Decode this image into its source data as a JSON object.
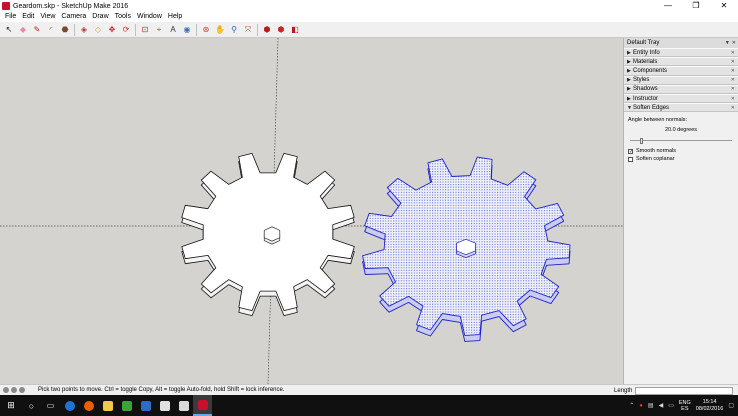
{
  "window": {
    "title": "Geardom.skp - SketchUp Make 2016",
    "minimize": "—",
    "maximize": "❐",
    "close": "✕"
  },
  "menu": [
    "File",
    "Edit",
    "View",
    "Camera",
    "Draw",
    "Tools",
    "Window",
    "Help"
  ],
  "toolbar": {
    "tools": [
      {
        "name": "select-tool",
        "glyph": "↖",
        "color": "#111111"
      },
      {
        "name": "eraser-tool",
        "glyph": "◆",
        "color": "#e887b5"
      },
      {
        "name": "line-tool",
        "glyph": "✎",
        "color": "#b02020"
      },
      {
        "name": "arc-tool",
        "glyph": "◜",
        "color": "#8a5a2b"
      },
      {
        "name": "shapes-tool",
        "glyph": "⬣",
        "color": "#7a4a2a"
      },
      {
        "name": "push-pull-tool",
        "glyph": "◈",
        "color": "#b83232"
      },
      {
        "name": "offset-tool",
        "glyph": "◇",
        "color": "#c8a040"
      },
      {
        "name": "move-tool",
        "glyph": "✥",
        "color": "#c62828"
      },
      {
        "name": "rotate-tool",
        "glyph": "⟳",
        "color": "#d32f2f"
      },
      {
        "name": "scale-tool",
        "glyph": "⊡",
        "color": "#c62828"
      },
      {
        "name": "tape-measure-tool",
        "glyph": "⌖",
        "color": "#8a7a2a"
      },
      {
        "name": "text-tool",
        "glyph": "A",
        "color": "#333333"
      },
      {
        "name": "paint-bucket-tool",
        "glyph": "◉",
        "color": "#3a6fb0"
      },
      {
        "name": "orbit-tool",
        "glyph": "⊛",
        "color": "#c0392b"
      },
      {
        "name": "pan-tool",
        "glyph": "✋",
        "color": "#b48a5a"
      },
      {
        "name": "zoom-tool",
        "glyph": "⚲",
        "color": "#2a60b0"
      },
      {
        "name": "zoom-extents-tool",
        "glyph": "⤧",
        "color": "#c0392b"
      },
      {
        "name": "3d-warehouse-tool",
        "glyph": "⬢",
        "color": "#b71c1c"
      },
      {
        "name": "extension-warehouse-tool",
        "glyph": "⬢",
        "color": "#c62828"
      },
      {
        "name": "layout-tool",
        "glyph": "◧",
        "color": "#b71c1c"
      }
    ]
  },
  "tray": {
    "title": "Default Tray",
    "sections": [
      {
        "label": "Entity Info",
        "expanded": false
      },
      {
        "label": "Materials",
        "expanded": false
      },
      {
        "label": "Components",
        "expanded": false
      },
      {
        "label": "Styles",
        "expanded": false
      },
      {
        "label": "Shadows",
        "expanded": false
      },
      {
        "label": "Instructor",
        "expanded": false
      },
      {
        "label": "Soften Edges",
        "expanded": true
      }
    ],
    "soften_edges": {
      "angle_label": "Angle between normals:",
      "angle_value": "20.0  degrees",
      "slider_fraction": 0.11,
      "smooth_normals_label": "Smooth normals",
      "smooth_normals_checked": true,
      "soften_coplanar_label": "Soften coplanar",
      "soften_coplanar_checked": false
    }
  },
  "status": {
    "hint": "Pick two points to move.  Ctrl = toggle Copy, Alt = toggle Auto-fold, hold Shift = lock inference.",
    "length_label": "Length",
    "length_value": ""
  },
  "viewport": {
    "background": "#d4d3cf",
    "gear_left": {
      "fill": "#ffffff",
      "stroke": "#111111",
      "teeth": 12
    },
    "gear_right": {
      "fill": "#e4e6f6",
      "stroke": "#1e22c8",
      "teeth": 13,
      "selected": true
    }
  },
  "taskbar": {
    "language": "ENG",
    "region": "ES",
    "time": "15:14",
    "date": "08/02/2016"
  }
}
